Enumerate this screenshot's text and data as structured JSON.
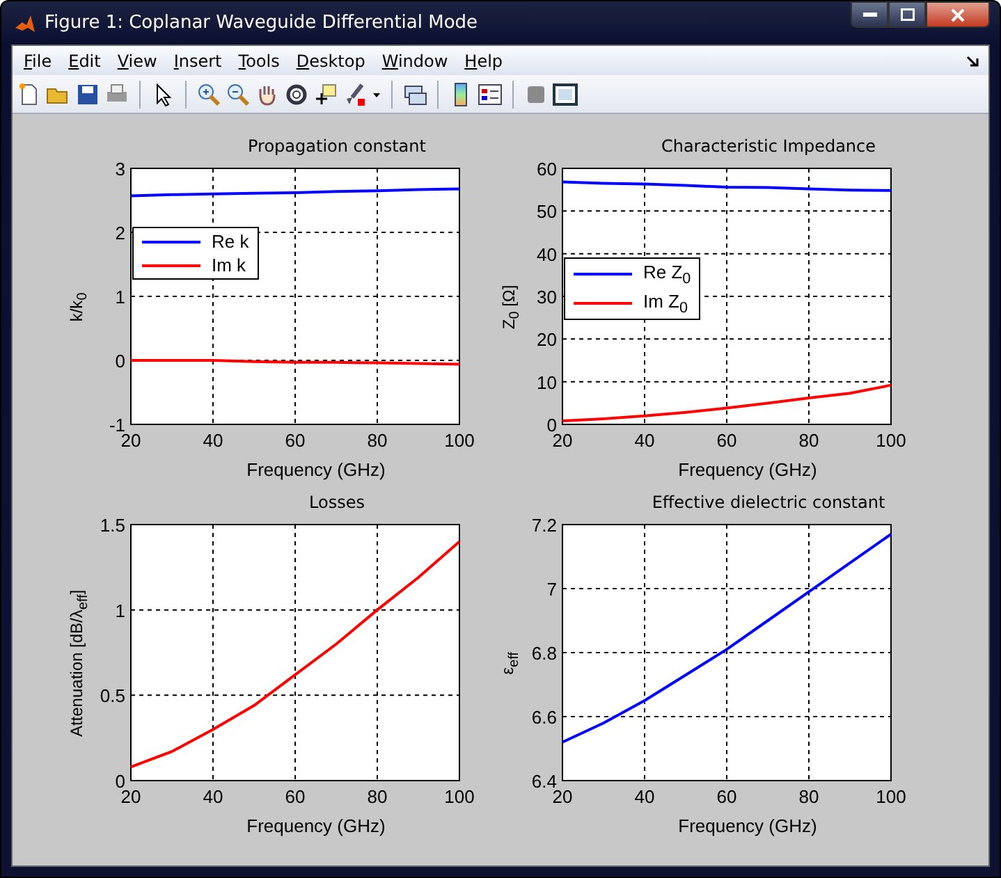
{
  "window": {
    "title": "Figure 1: Coplanar Waveguide Differential Mode"
  },
  "menu": [
    "File",
    "Edit",
    "View",
    "Insert",
    "Tools",
    "Desktop",
    "Window",
    "Help"
  ],
  "plots": [
    {
      "chart_data": {
        "type": "line",
        "title": "Propagation constant",
        "xlabel": "Frequency (GHz)",
        "ylabel": "k/k$_{0}$",
        "x": [
          20,
          30,
          40,
          50,
          60,
          70,
          80,
          90,
          100
        ],
        "series": [
          {
            "name": "Re k",
            "color": "#0000ff",
            "values": [
              2.57,
              2.59,
              2.6,
              2.61,
              2.62,
              2.64,
              2.65,
              2.67,
              2.68
            ]
          },
          {
            "name": "Im k",
            "color": "#ff0000",
            "values": [
              0,
              0,
              0,
              -0.02,
              -0.03,
              -0.03,
              -0.04,
              -0.05,
              -0.06
            ]
          }
        ],
        "xlim": [
          20,
          100
        ],
        "ylim": [
          -1,
          3
        ],
        "xticks": [
          20,
          40,
          60,
          80,
          100
        ],
        "yticks": [
          -1,
          0,
          1,
          2,
          3
        ],
        "grid": true,
        "legend": true
      }
    },
    {
      "chart_data": {
        "type": "line",
        "title": "Characteristic Impedance",
        "xlabel": "Frequency (GHz)",
        "ylabel": "Z$_{0}$ [Ω]",
        "x": [
          20,
          30,
          40,
          50,
          60,
          70,
          80,
          90,
          100
        ],
        "series": [
          {
            "name": "Re Z$_{0}$",
            "color": "#0000ff",
            "values": [
              56.8,
              56.5,
              56.3,
              56.0,
              55.6,
              55.5,
              55.2,
              54.9,
              54.8
            ]
          },
          {
            "name": "Im Z$_{0}$",
            "color": "#ff0000",
            "values": [
              0.8,
              1.3,
              2.0,
              2.8,
              3.8,
              5.0,
              6.2,
              7.3,
              9.2
            ]
          }
        ],
        "xlim": [
          20,
          100
        ],
        "ylim": [
          0,
          60
        ],
        "xticks": [
          20,
          40,
          60,
          80,
          100
        ],
        "yticks": [
          0,
          10,
          20,
          30,
          40,
          50,
          60
        ],
        "grid": true,
        "legend": true
      }
    },
    {
      "chart_data": {
        "type": "line",
        "title": "Losses",
        "xlabel": "Frequency (GHz)",
        "ylabel": "Attenuation [dB/λ$_{eff}$]",
        "x": [
          20,
          30,
          40,
          50,
          60,
          70,
          80,
          90,
          100
        ],
        "series": [
          {
            "color": "#ff0000",
            "values": [
              0.08,
              0.17,
              0.3,
              0.44,
              0.62,
              0.8,
              1.0,
              1.19,
              1.4
            ]
          }
        ],
        "xlim": [
          20,
          100
        ],
        "ylim": [
          0,
          1.5
        ],
        "xticks": [
          20,
          40,
          60,
          80,
          100
        ],
        "yticks": [
          0,
          0.5,
          1,
          1.5
        ],
        "grid": true
      }
    },
    {
      "chart_data": {
        "type": "line",
        "title": "Effective dielectric constant",
        "xlabel": "Frequency (GHz)",
        "ylabel": "ε$_{eff}$",
        "x": [
          20,
          30,
          40,
          50,
          60,
          70,
          80,
          90,
          100
        ],
        "series": [
          {
            "color": "#0000ff",
            "values": [
              6.52,
              6.58,
              6.65,
              6.73,
              6.81,
              6.9,
              6.99,
              7.08,
              7.17
            ]
          }
        ],
        "xlim": [
          20,
          100
        ],
        "ylim": [
          6.4,
          7.2
        ],
        "xticks": [
          20,
          40,
          60,
          80,
          100
        ],
        "yticks": [
          6.4,
          6.6,
          6.8,
          7,
          7.2
        ],
        "grid": true
      }
    }
  ]
}
